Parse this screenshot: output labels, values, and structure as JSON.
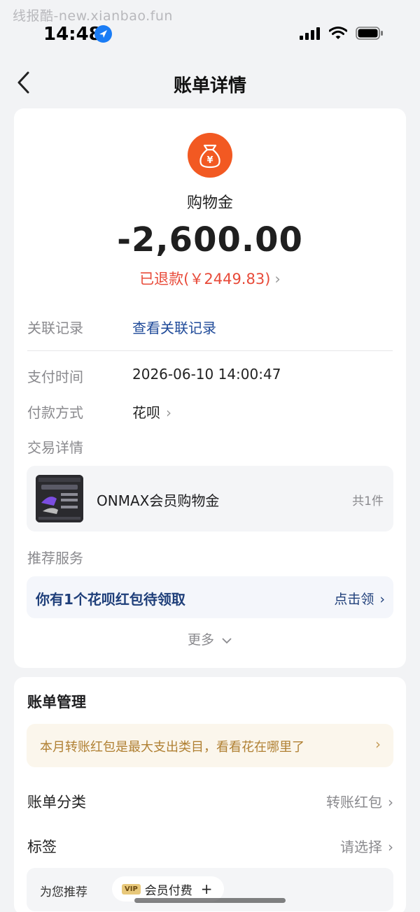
{
  "watermark": "线报酷-new.xianbao.fun",
  "status_bar": {
    "time": "14:48"
  },
  "nav": {
    "title": "账单详情"
  },
  "hero": {
    "name": "购物金",
    "amount": "-2,600.00",
    "refund_text": "已退款(￥2449.83)",
    "icon": "money-bag-icon",
    "icon_color": "#f25922"
  },
  "details": {
    "related_label": "关联记录",
    "related_value": "查看关联记录",
    "pay_time_label": "支付时间",
    "pay_time_value": "2026-06-10 14:00:47",
    "pay_method_label": "付款方式",
    "pay_method_value": "花呗",
    "trade_detail_label": "交易详情"
  },
  "product": {
    "name": "ONMAX会员购物金",
    "count": "共1件"
  },
  "recommend": {
    "label": "推荐服务",
    "promo_text": "你有1个花呗红包待领取",
    "promo_action": "点击领",
    "more": "更多"
  },
  "management": {
    "title": "账单管理",
    "tip": "本月转账红包是最大支出类目，看看花在哪里了",
    "category_label": "账单分类",
    "category_value": "转账红包",
    "tag_label": "标签",
    "tag_value": "请选择",
    "rec_label": "为您推荐",
    "rec_chip_badge": "VIP",
    "rec_chip_text": "会员付费"
  },
  "colors": {
    "accent_red": "#e84b3a",
    "link_blue": "#1f4a99",
    "tip_gold": "#b08033"
  }
}
